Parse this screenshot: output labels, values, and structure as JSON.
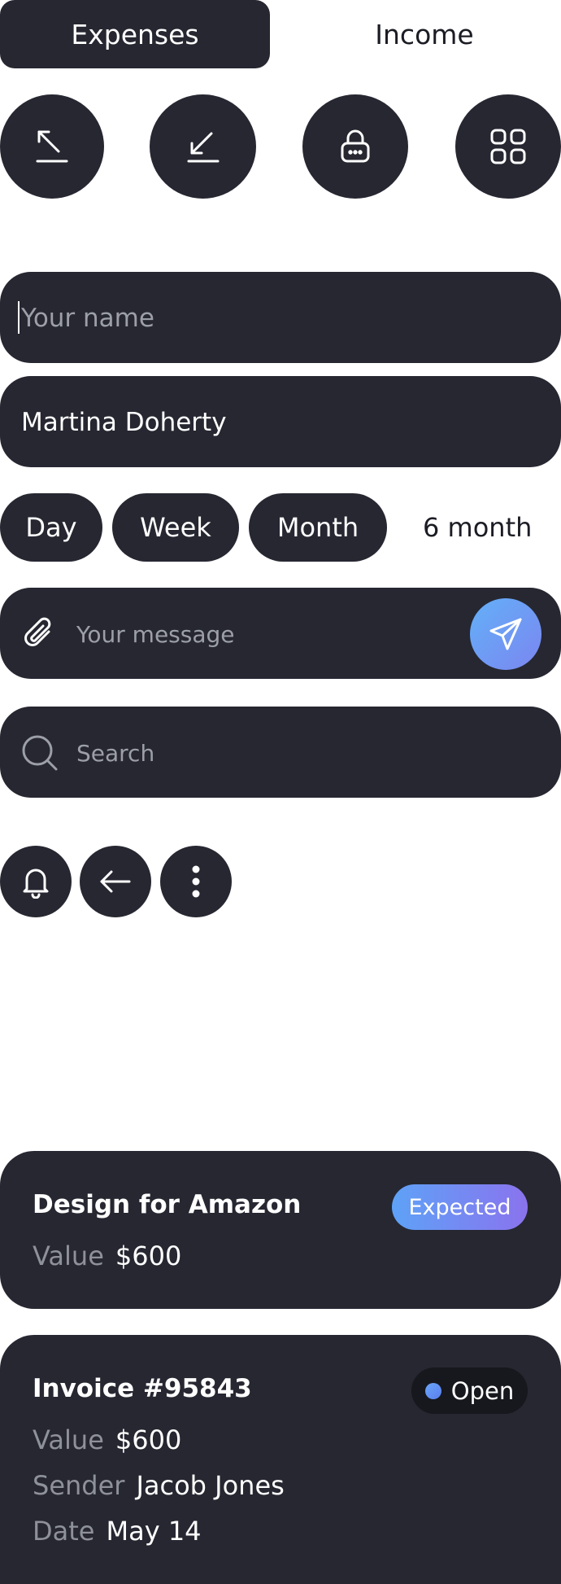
{
  "tabs": {
    "active": "Expenses",
    "inactive": "Income"
  },
  "quick_actions": [
    {
      "icon": "arrow-up-left-icon"
    },
    {
      "icon": "arrow-down-left-icon"
    },
    {
      "icon": "lock-icon"
    },
    {
      "icon": "grid-icon"
    }
  ],
  "name_field": {
    "placeholder": "Your name"
  },
  "name_filled": {
    "value": "Martina Doherty"
  },
  "period_filter": {
    "options": [
      "Day",
      "Week",
      "Month",
      "6 month"
    ]
  },
  "message": {
    "placeholder": "Your message",
    "attach_icon": "paperclip-icon",
    "send_icon": "send-icon"
  },
  "search": {
    "placeholder": "Search",
    "icon": "search-icon"
  },
  "small_buttons": [
    {
      "icon": "bell-icon"
    },
    {
      "icon": "arrow-left-icon"
    },
    {
      "icon": "more-vertical-icon"
    }
  ],
  "card_design": {
    "title": "Design for Amazon",
    "badge": "Expected",
    "value_label": "Value",
    "value": "$600"
  },
  "card_invoice": {
    "title": "Invoice #95843",
    "badge": "Open",
    "value_label": "Value",
    "value": "$600",
    "sender_label": "Sender",
    "sender": "Jacob Jones",
    "date_label": "Date",
    "date": "May 14"
  },
  "colors": {
    "surface": "#262731",
    "accent_gradient_start": "#5ea2f7",
    "accent_gradient_end": "#8a73ee"
  }
}
